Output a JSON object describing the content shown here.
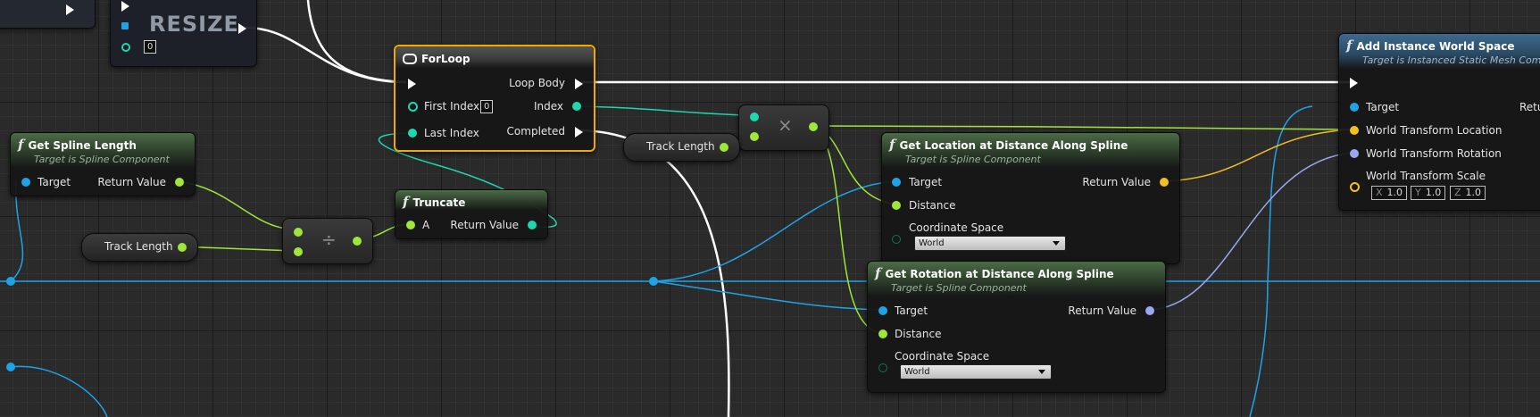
{
  "resize_node": {
    "title": "RESIZE",
    "value": "0"
  },
  "forloop": {
    "title": "ForLoop",
    "loop_body": "Loop Body",
    "first_index": "First Index",
    "first_index_value": "0",
    "index": "Index",
    "last_index": "Last Index",
    "completed": "Completed"
  },
  "get_spline_length": {
    "title": "Get Spline Length",
    "subtitle": "Target is Spline Component",
    "target": "Target",
    "return_value": "Return Value"
  },
  "track_length_1": {
    "label": "Track Length"
  },
  "track_length_2": {
    "label": "Track Length"
  },
  "divide_node": {
    "symbol": "÷"
  },
  "truncate": {
    "title": "Truncate",
    "a": "A",
    "return_value": "Return Value"
  },
  "multiply_node": {
    "symbol": "×"
  },
  "get_location": {
    "title": "Get Location at Distance Along Spline",
    "subtitle": "Target is Spline Component",
    "target": "Target",
    "return_value": "Return Value",
    "distance": "Distance",
    "coordinate_space": "Coordinate Space",
    "coordinate_value": "World"
  },
  "get_rotation": {
    "title": "Get Rotation at Distance Along Spline",
    "subtitle": "Target is Spline Component",
    "target": "Target",
    "return_value": "Return Value",
    "distance": "Distance",
    "coordinate_space": "Coordinate Space",
    "coordinate_value": "World"
  },
  "add_instance": {
    "title": "Add Instance World Space",
    "subtitle": "Target is Instanced Static Mesh Com",
    "target": "Target",
    "return_partial": "Retu",
    "world_location": "World Transform Location",
    "world_rotation": "World Transform Rotation",
    "world_scale": "World Transform Scale",
    "scale_x_label": "X",
    "scale_x": "1.0",
    "scale_y_label": "Y",
    "scale_y": "1.0",
    "scale_z_label": "Z",
    "scale_z": "1.0"
  },
  "colors": {
    "float_pin": "#9ee63a",
    "int_pin": "#1ed7ae",
    "object_pin": "#1fa2e6",
    "vector_pin": "#f2be22",
    "rotator_pin": "#9aa8f0",
    "exec_wire": "#ffffff",
    "selected_border": "#f2a900"
  }
}
